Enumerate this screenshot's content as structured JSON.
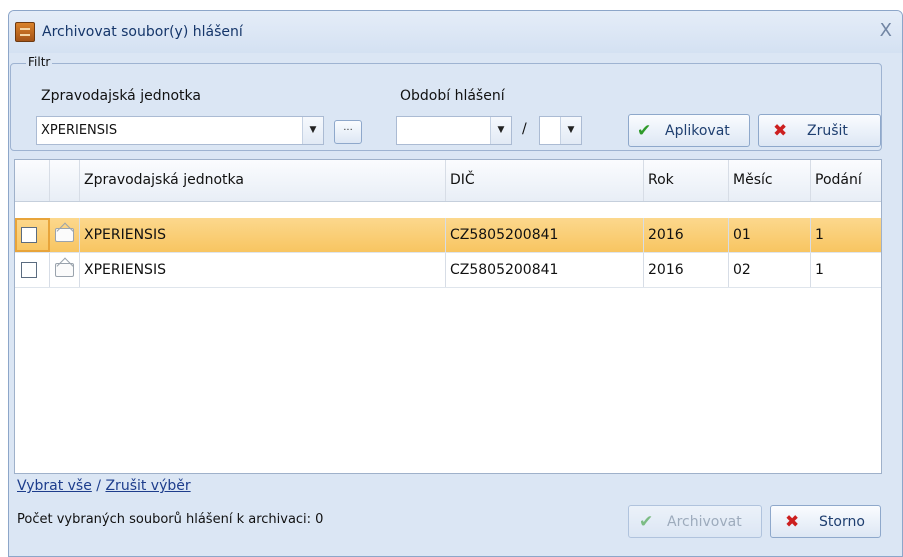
{
  "window": {
    "title": "Archivovat soubor(y) hlášení",
    "close_glyph": "X"
  },
  "filter": {
    "legend": "Filtr",
    "unit_label": "Zpravodajská jednotka",
    "unit_value": "XPERIENSIS",
    "browse_label": "...",
    "period_label": "Období hlášení",
    "period_separator": "/",
    "apply_label": "Aplikovat",
    "cancel_label": "Zrušit"
  },
  "grid": {
    "columns": [
      "Zpravodajská jednotka",
      "DIČ",
      "Rok",
      "Měsíc",
      "Podání"
    ],
    "rows": [
      {
        "unit": "XPERIENSIS",
        "dic": "CZ5805200841",
        "rok": "2016",
        "mesic": "01",
        "podani": "1",
        "selected": true
      },
      {
        "unit": "XPERIENSIS",
        "dic": "CZ5805200841",
        "rok": "2016",
        "mesic": "02",
        "podani": "1",
        "selected": false
      }
    ]
  },
  "footer": {
    "select_all": "Vybrat vše",
    "separator": "/",
    "deselect": "Zrušit výběr",
    "status": "Počet vybraných souborů hlášení k archivaci: 0",
    "archive_label": "Archivovat",
    "close_label": "Storno"
  },
  "colors": {
    "accent": "#2f9a2a",
    "danger": "#cc1f1f",
    "selection": "#f9cf72",
    "frame": "#dbe6f4"
  }
}
